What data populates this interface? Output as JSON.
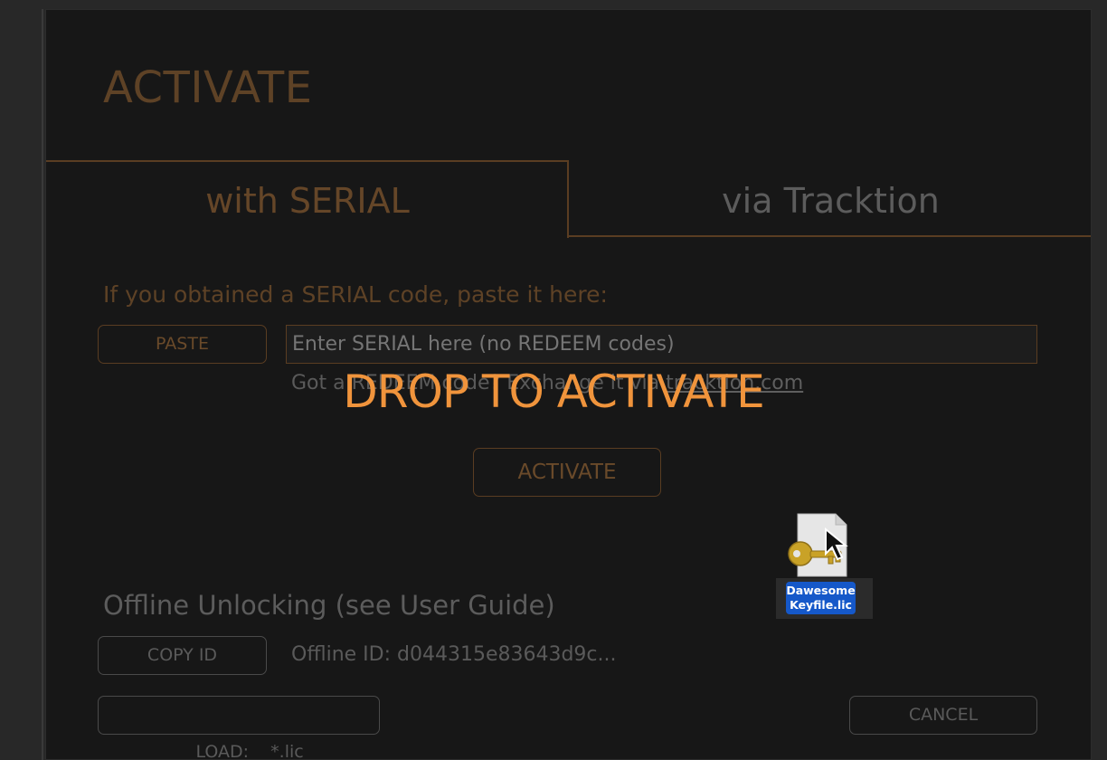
{
  "dialog": {
    "title": "ACTIVATE",
    "tabs": [
      {
        "label": "with SERIAL",
        "active": true
      },
      {
        "label": "via Tracktion",
        "active": false
      }
    ],
    "serial": {
      "prompt": "If you obtained a SERIAL code, paste it here:",
      "paste_label": "PASTE",
      "input_placeholder": "Enter SERIAL here (no REDEEM codes)",
      "redeem_prefix": "Got a REDEEM code? Exchange it via ",
      "redeem_link": "tracktion.com",
      "activate_label": "ACTIVATE"
    },
    "offline": {
      "title": "Offline Unlocking (see User Guide)",
      "copy_id_label": "COPY ID",
      "offline_id": "Offline ID: d044315e83643d9c...",
      "load_label": "LOAD:    *.lic",
      "cancel_label": "CANCEL"
    }
  },
  "overlay": {
    "drop_text": "DROP TO ACTIVATE"
  },
  "dragged_file": {
    "icon": "key-file-icon",
    "name_line1": "Dawesome",
    "name_line2": "Keyfile.lic"
  },
  "colors": {
    "accent": "#f0943c",
    "brown": "#5e4226",
    "file_label_bg": "#1558c9"
  }
}
